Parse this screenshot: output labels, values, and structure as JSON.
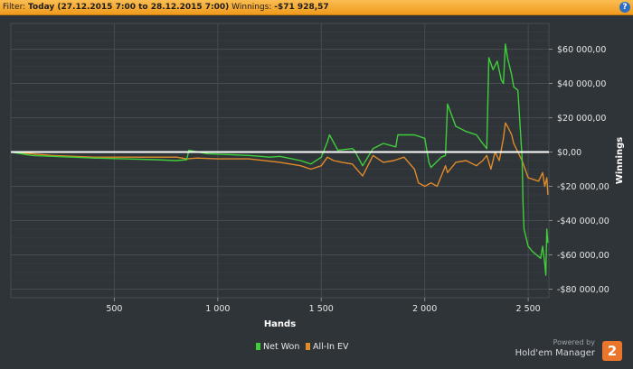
{
  "filter": {
    "prefix": "Filter: ",
    "range": "Today (27.12.2015 7:00 to 28.12.2015 7:00)",
    "winnings_label": " Winnings: ",
    "winnings_value": "-$71 928,57",
    "help_glyph": "?"
  },
  "branding": {
    "powered": "Powered by",
    "name": "Hold'em Manager",
    "logo_glyph": "2"
  },
  "colors": {
    "net_won": "#3fcf3a",
    "allin_ev": "#e08a2a",
    "zero_line": "#ffffff",
    "grid": "#454b50",
    "text": "#e6e6e6"
  },
  "chart_data": {
    "type": "line",
    "xlabel": "Hands",
    "ylabel": "Winnings",
    "xlim": [
      0,
      2600
    ],
    "ylim": [
      -85000,
      75000
    ],
    "x_ticks": [
      500,
      1000,
      1500,
      2000,
      2500
    ],
    "x_tick_labels": [
      "500",
      "1 000",
      "1 500",
      "2 000",
      "2 500"
    ],
    "y_ticks": [
      60000,
      40000,
      20000,
      0,
      -20000,
      -40000,
      -60000,
      -80000
    ],
    "y_tick_labels": [
      "$60 000,00",
      "$40 000,00",
      "$20 000,00",
      "$0,00",
      "-$20 000,00",
      "-$40 000,00",
      "-$60 000,00",
      "-$80 000,00"
    ],
    "legend_position": "bottom-center",
    "series": [
      {
        "name": "Net Won",
        "x": [
          0,
          100,
          200,
          300,
          400,
          550,
          700,
          800,
          850,
          860,
          950,
          1050,
          1150,
          1250,
          1300,
          1400,
          1450,
          1500,
          1530,
          1540,
          1580,
          1650,
          1660,
          1700,
          1750,
          1800,
          1860,
          1870,
          1950,
          2000,
          2020,
          2030,
          2080,
          2100,
          2110,
          2150,
          2200,
          2250,
          2280,
          2300,
          2310,
          2330,
          2350,
          2370,
          2380,
          2390,
          2400,
          2420,
          2430,
          2450,
          2470,
          2475,
          2480,
          2490,
          2500,
          2520,
          2540,
          2560,
          2570,
          2580,
          2585,
          2590,
          2595
        ],
        "values": [
          0,
          -2000,
          -2500,
          -3000,
          -3500,
          -4000,
          -4500,
          -5000,
          -4500,
          1000,
          -1000,
          -1500,
          -2000,
          -3000,
          -2500,
          -5000,
          -7000,
          -3000,
          6000,
          10000,
          1000,
          2000,
          1000,
          -8000,
          2000,
          5000,
          3000,
          10000,
          10000,
          8000,
          -6000,
          -9000,
          -3000,
          -2000,
          28000,
          15000,
          12000,
          10000,
          5000,
          2000,
          55000,
          48000,
          53000,
          42000,
          40000,
          63000,
          55000,
          45000,
          38000,
          36000,
          -3000,
          -30000,
          -45000,
          -50000,
          -55000,
          -58000,
          -60000,
          -62000,
          -55000,
          -65000,
          -71900,
          -45000,
          -53000
        ]
      },
      {
        "name": "All-In EV",
        "x": [
          0,
          200,
          400,
          600,
          800,
          850,
          900,
          1000,
          1150,
          1300,
          1400,
          1450,
          1500,
          1530,
          1560,
          1600,
          1650,
          1700,
          1750,
          1800,
          1850,
          1900,
          1950,
          1970,
          2000,
          2030,
          2060,
          2100,
          2110,
          2150,
          2200,
          2250,
          2280,
          2300,
          2320,
          2340,
          2360,
          2380,
          2390,
          2400,
          2420,
          2430,
          2450,
          2470,
          2500,
          2550,
          2570,
          2580,
          2590,
          2595
        ],
        "values": [
          0,
          -2000,
          -3000,
          -3000,
          -3000,
          -4000,
          -3500,
          -4000,
          -4000,
          -6000,
          -8000,
          -10000,
          -8000,
          -3000,
          -5000,
          -6000,
          -7000,
          -14000,
          -2000,
          -6000,
          -5000,
          -3000,
          -10000,
          -18000,
          -20000,
          -18000,
          -20000,
          -8000,
          -12000,
          -6000,
          -5000,
          -8000,
          -5000,
          -2000,
          -10000,
          0,
          -5000,
          8000,
          17000,
          15000,
          10000,
          5000,
          0,
          -5000,
          -15000,
          -17000,
          -12000,
          -20000,
          -15000,
          -25000
        ]
      }
    ]
  }
}
